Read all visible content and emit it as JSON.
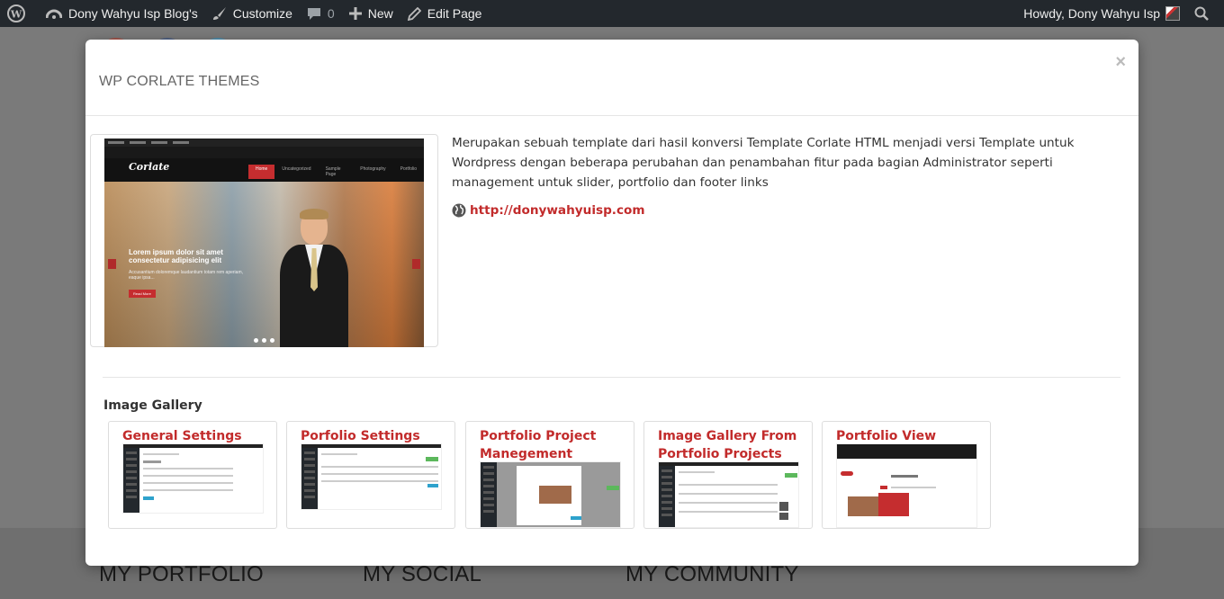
{
  "admin_bar": {
    "site_name": "Dony Wahyu Isp Blog's",
    "customize": "Customize",
    "comments_count": "0",
    "new": "New",
    "edit_page": "Edit Page",
    "howdy": "Howdy, Dony Wahyu Isp"
  },
  "modal": {
    "title": "WP CORLATE THEMES",
    "close": "×",
    "description": "Merupakan sebuah template dari hasil konversi Template Corlate  HTML menjadi versi Template untuk Wordpress dengan beberapa perubahan dan penambahan fitur pada bagian Administrator seperti management untuk slider, portfolio dan footer links",
    "link": "http://donywahyuisp.com",
    "preview": {
      "logo": "Corlate",
      "nav": [
        "Home",
        "Uncategorized",
        "Sample Page",
        "Photography",
        "Portfolio"
      ],
      "caption": "Lorem ipsum dolor sit amet consectetur adipisicing elit",
      "sub": "Accusantium doloremque laudantium totam rem aperiam, eaque ipsa...",
      "button": "Read More"
    },
    "gallery_title": "Image Gallery",
    "gallery": [
      {
        "title": "General Settings"
      },
      {
        "title": "Porfolio Settings"
      },
      {
        "title": "Portfolio Project Manegement"
      },
      {
        "title": "Image Gallery From Portfolio Projects"
      },
      {
        "title": "Portfolio View"
      }
    ]
  },
  "footer": {
    "col1": "MY PORTFOLIO",
    "col2": "MY SOCIAL",
    "col3": "MY COMMUNITY"
  },
  "colors": {
    "accent": "#c22b2b",
    "admin_bar": "#23282d"
  }
}
